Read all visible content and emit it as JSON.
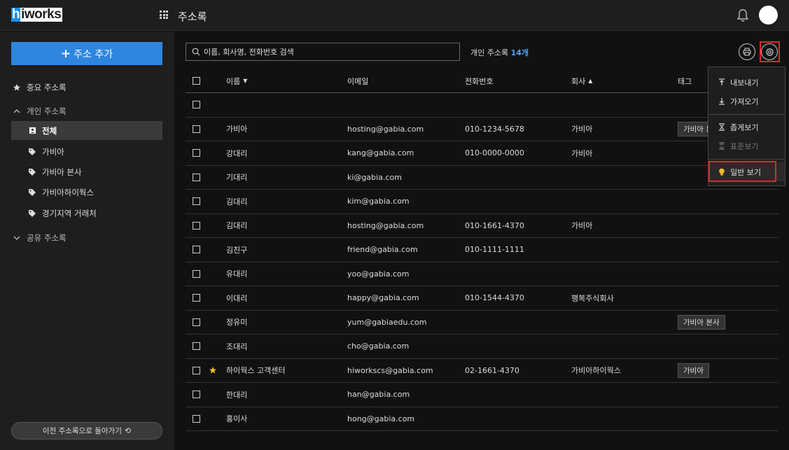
{
  "colors": {
    "accent": "#2e86de",
    "highlight": "#e0282e",
    "count": "#4da3ff",
    "star": "#f5b82e"
  },
  "header": {
    "logo_h": "h",
    "logo_rest": "iworks",
    "title": "주소록",
    "icons": {
      "apps": "apps-grid-icon",
      "notifications": "bell-icon"
    }
  },
  "sidebar": {
    "add_button": "주소 추가",
    "favorites": "중요 주소록",
    "personal_section": "개인 주소록",
    "items": [
      {
        "label": "전체",
        "icon": "contact-card-icon"
      },
      {
        "label": "가비아",
        "icon": "tag-icon"
      },
      {
        "label": "가비아 본사",
        "icon": "tag-icon"
      },
      {
        "label": "가비아하이웍스",
        "icon": "tag-icon"
      },
      {
        "label": "경기지역 거래처",
        "icon": "tag-icon"
      }
    ],
    "shared_section": "공유 주소록",
    "back_button": "이전 주소록으로 돌아가기"
  },
  "search": {
    "placeholder": "이름, 회사명, 전화번호 검색"
  },
  "count": {
    "label": "개인 주소록",
    "value": "14개"
  },
  "table": {
    "columns": {
      "name": "이름",
      "email": "이메일",
      "phone": "전화번호",
      "company": "회사",
      "tag": "태그"
    },
    "rows": [
      {
        "name": "",
        "email": "",
        "phone": "",
        "company": "",
        "tag": "",
        "starred": false
      },
      {
        "name": "가비아",
        "email": "hosting@gabia.com",
        "phone": "010-1234-5678",
        "company": "가비아",
        "tag": "가비아 본",
        "starred": false
      },
      {
        "name": "강대리",
        "email": "kang@gabia.com",
        "phone": "010-0000-0000",
        "company": "가비아",
        "tag": "",
        "starred": false
      },
      {
        "name": "기대리",
        "email": "ki@gabia.com",
        "phone": "",
        "company": "",
        "tag": "",
        "starred": false
      },
      {
        "name": "김대리",
        "email": "kim@gabia.com",
        "phone": "",
        "company": "",
        "tag": "",
        "starred": false
      },
      {
        "name": "김대리",
        "email": "hosting@gabia.com",
        "phone": "010-1661-4370",
        "company": "가비아",
        "tag": "",
        "starred": false
      },
      {
        "name": "김친구",
        "email": "friend@gabia.com",
        "phone": "010-1111-1111",
        "company": "",
        "tag": "",
        "starred": false
      },
      {
        "name": "유대리",
        "email": "yoo@gabia.com",
        "phone": "",
        "company": "",
        "tag": "",
        "starred": false
      },
      {
        "name": "이대리",
        "email": "happy@gabia.com",
        "phone": "010-1544-4370",
        "company": "행복주식회사",
        "tag": "",
        "starred": false
      },
      {
        "name": "정유미",
        "email": "yum@gabiaedu.com",
        "phone": "",
        "company": "",
        "tag": "가비아 본사",
        "starred": false
      },
      {
        "name": "조대리",
        "email": "cho@gabia.com",
        "phone": "",
        "company": "",
        "tag": "",
        "starred": false
      },
      {
        "name": "하이웍스 고객센터",
        "email": "hiworkscs@gabia.com",
        "phone": "02-1661-4370",
        "company": "가비아하이웍스",
        "tag": "가비아",
        "starred": true
      },
      {
        "name": "한대리",
        "email": "han@gabia.com",
        "phone": "",
        "company": "",
        "tag": "",
        "starred": false
      },
      {
        "name": "홍이사",
        "email": "hong@gabia.com",
        "phone": "",
        "company": "",
        "tag": "",
        "starred": false
      }
    ]
  },
  "dropdown": {
    "export": "내보내기",
    "import": "가져오기",
    "compact_view": "좁게보기",
    "standard_view": "표준보기",
    "normal_view": "일반 보기"
  }
}
